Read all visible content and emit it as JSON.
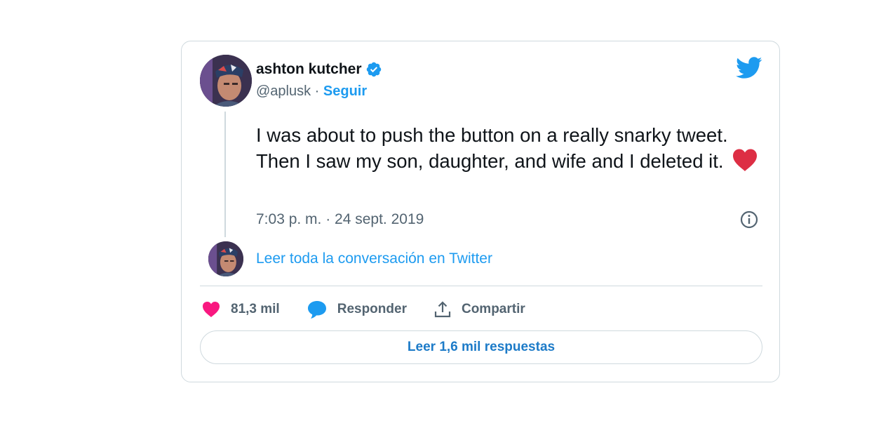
{
  "tweet": {
    "author": {
      "name": "ashton kutcher",
      "handle": "@aplusk",
      "separator": " · ",
      "follow_label": "Seguir",
      "verified": true
    },
    "text": "I was about to push the button on a really snarky tweet. Then I saw my son, daughter, and wife and I deleted it.",
    "emoji": "red-heart",
    "timestamp": "7:03 p. m. · 24 sept. 2019",
    "conversation_link": "Leer toda la conversación en Twitter",
    "actions": {
      "likes": "81,3 mil",
      "reply_label": "Responder",
      "share_label": "Compartir"
    },
    "read_replies_label": "Leer 1,6 mil respuestas"
  },
  "icons": [
    "avatar",
    "verified-badge-icon",
    "twitter-bird-icon",
    "red-heart-emoji",
    "info-icon",
    "like-heart-icon",
    "reply-bubble-icon",
    "share-icon"
  ],
  "colors": {
    "brand_blue": "#1d9bf0",
    "like_pink": "#f91880",
    "text_primary": "#0f1419",
    "text_secondary": "#536471",
    "border": "#cfd9de"
  }
}
